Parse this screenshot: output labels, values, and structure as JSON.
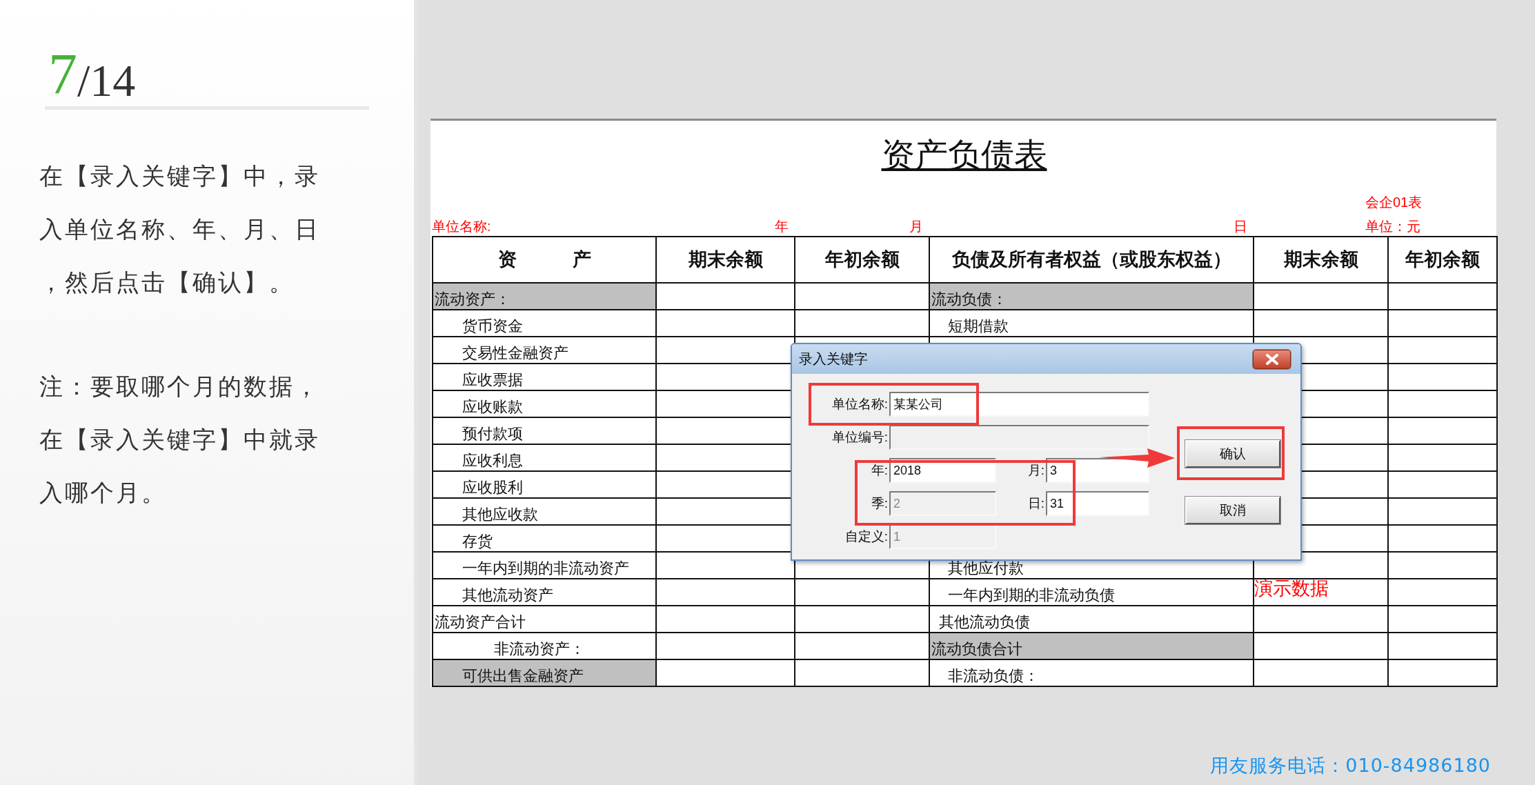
{
  "slide": {
    "page_current": "7",
    "page_total": "/14",
    "paragraphs": [
      "在【录入关键字】中，录入单位名称、年、月、日，然后点击【确认】。",
      "注：要取哪个月的数据，在【录入关键字】中就录入哪个月。"
    ]
  },
  "sheet": {
    "title": "资产负债表",
    "form_code": "会企01表",
    "header_labels": [
      "单位名称:",
      "年",
      "月",
      "日",
      "单位：元"
    ],
    "columns": [
      "资　　　产",
      "期末余额",
      "年初余额",
      "负债及所有者权益（或股东权益）",
      "期末余额",
      "年初余额"
    ],
    "rows": [
      {
        "asset": {
          "text": "流动资产：",
          "kind": "section",
          "shaded": true
        },
        "liability": {
          "text": "流动负债：",
          "kind": "section",
          "shaded": true
        }
      },
      {
        "asset": {
          "text": "货币资金",
          "kind": "item",
          "shaded": false
        },
        "liability": {
          "text": "短期借款",
          "kind": "item",
          "shaded": false
        }
      },
      {
        "asset": {
          "text": "交易性金融资产",
          "kind": "item",
          "shaded": false
        }
      },
      {
        "asset": {
          "text": "应收票据",
          "kind": "item",
          "shaded": false
        }
      },
      {
        "asset": {
          "text": "应收账款",
          "kind": "item",
          "shaded": false
        }
      },
      {
        "asset": {
          "text": "预付款项",
          "kind": "item",
          "shaded": false
        }
      },
      {
        "asset": {
          "text": "应收利息",
          "kind": "item",
          "shaded": false
        }
      },
      {
        "asset": {
          "text": "应收股利",
          "kind": "item",
          "shaded": false
        }
      },
      {
        "asset": {
          "text": "其他应收款",
          "kind": "item",
          "shaded": false
        }
      },
      {
        "asset": {
          "text": "存货",
          "kind": "item",
          "shaded": false
        }
      },
      {
        "asset": {
          "text": "一年内到期的非流动资产",
          "kind": "item",
          "shaded": false
        },
        "liability": {
          "text": "其他应付款",
          "kind": "item",
          "shaded": false
        }
      },
      {
        "asset": {
          "text": "其他流动资产",
          "kind": "item",
          "shaded": false
        },
        "liability": {
          "text": "一年内到期的非流动负债",
          "kind": "item",
          "shaded": false
        },
        "column_5": "演示数据"
      },
      {
        "asset": {
          "text": "流动资产合计",
          "kind": "total",
          "shaded": false
        },
        "liability": {
          "text": "其他流动负债",
          "kind": "minor",
          "shaded": false
        }
      },
      {
        "asset": {
          "text": "非流动资产：",
          "kind": "subsection",
          "shaded": false
        },
        "liability": {
          "text": "流动负债合计",
          "kind": "total",
          "shaded": true
        }
      },
      {
        "asset": {
          "text": "可供出售金融资产",
          "kind": "item",
          "shaded": true
        },
        "liability": {
          "text": "非流动负债：",
          "kind": "item",
          "shaded": false
        }
      }
    ]
  },
  "dialog": {
    "title": "录入关键字",
    "fields": [
      {
        "label": "单位名称:",
        "value": "某某公司",
        "kind": "wide",
        "disabled": false
      },
      {
        "label": "单位编号:",
        "kind": "wide",
        "disabled": true
      },
      {
        "label": "年:",
        "value": "2018",
        "kind": "narrow",
        "disabled": false
      },
      {
        "label": "月:",
        "value": "3",
        "kind": "narrow",
        "disabled": false
      },
      {
        "label": "季:",
        "value": "2",
        "kind": "narrow",
        "disabled": true
      },
      {
        "label": "日:",
        "value": "31",
        "kind": "narrow",
        "disabled": false
      },
      {
        "label": "自定义:",
        "value": "1",
        "kind": "narrow",
        "disabled": true
      }
    ],
    "buttons": [
      "确认",
      "取消"
    ]
  },
  "footer": "用友服务电话：010-84986180"
}
